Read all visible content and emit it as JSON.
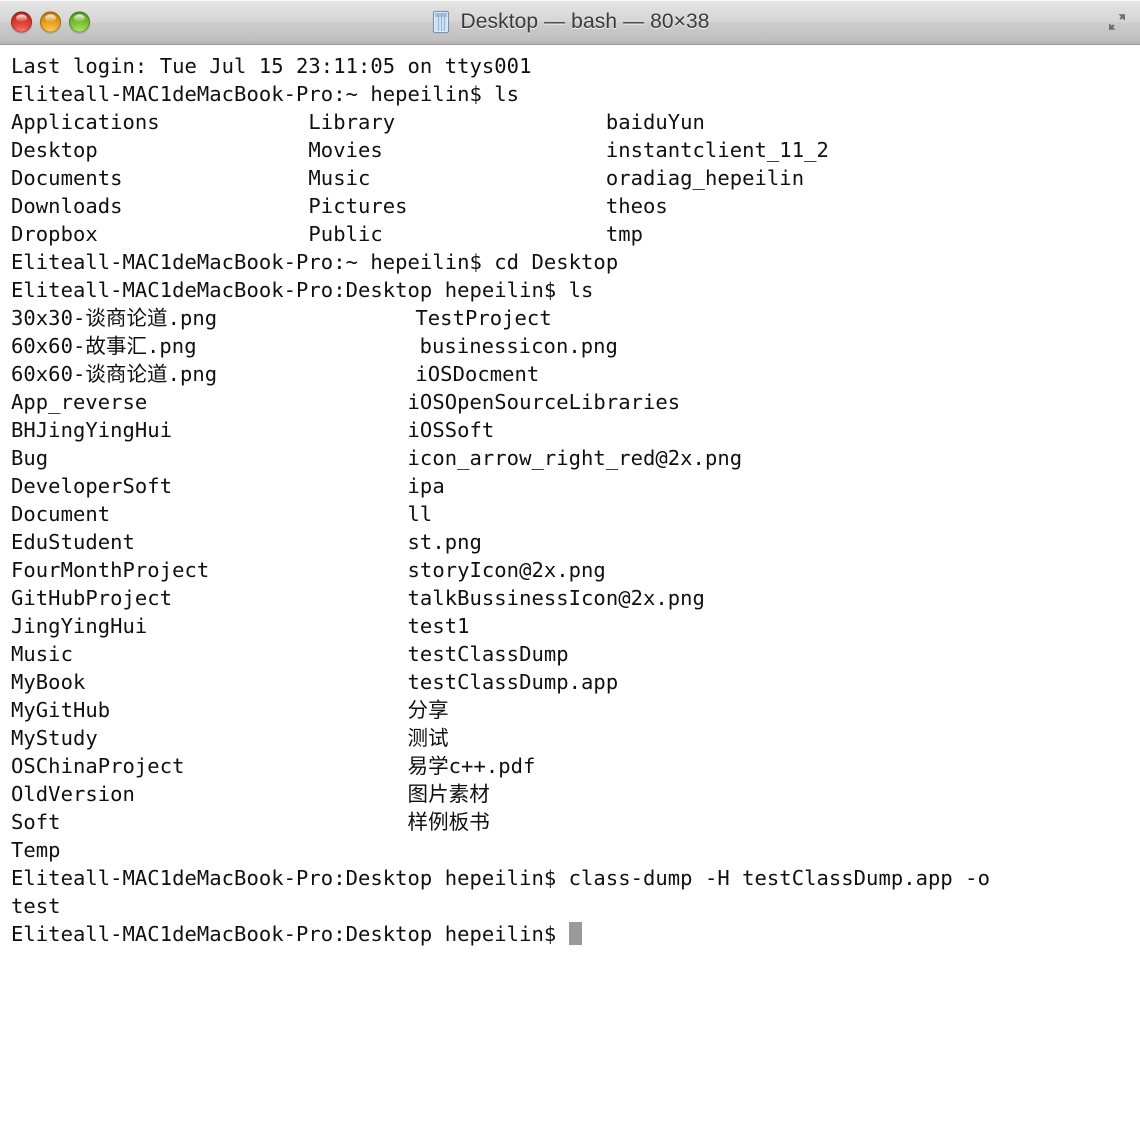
{
  "window": {
    "title": "Desktop — bash — 80×38",
    "title_icon": "terminal-document-icon",
    "buttons": {
      "close": "close-button",
      "minimize": "minimize-button",
      "zoom": "zoom-button",
      "fullscreen": "fullscreen-button"
    }
  },
  "colors": {
    "background": "#ffffff",
    "foreground": "#101010",
    "cursor": "#9a9a9a",
    "titlebar_top": "#e9e9e9",
    "titlebar_bottom": "#b2b2b2",
    "close_red": "#e8463c",
    "minimize_yellow": "#f0ab28",
    "zoom_green": "#87c93d"
  },
  "terminal": {
    "cols": 80,
    "rows": 38,
    "shell": "bash",
    "lines": [
      "Last login: Tue Jul 15 23:11:05 on ttys001",
      "Eliteall-MAC1deMacBook-Pro:~ hepeilin$ ls",
      "Applications            Library                 baiduYun",
      "Desktop                 Movies                  instantclient_11_2",
      "Documents               Music                   oradiag_hepeilin",
      "Downloads               Pictures                theos",
      "Dropbox                 Public                  tmp",
      "Eliteall-MAC1deMacBook-Pro:~ hepeilin$ cd Desktop",
      "Eliteall-MAC1deMacBook-Pro:Desktop hepeilin$ ls",
      "30x30-谈商论道.png                TestProject",
      "60x60-故事汇.png                  businessicon.png",
      "60x60-谈商论道.png                iOSDocment",
      "App_reverse                     iOSOpenSourceLibraries",
      "BHJingYingHui                   iOSSoft",
      "Bug                             icon_arrow_right_red@2x.png",
      "DeveloperSoft                   ipa",
      "Document                        ll",
      "EduStudent                      st.png",
      "FourMonthProject                storyIcon@2x.png",
      "GitHubProject                   talkBussinessIcon@2x.png",
      "JingYingHui                     test1",
      "Music                           testClassDump",
      "MyBook                          testClassDump.app",
      "MyGitHub                        分享",
      "MyStudy                         测试",
      "OSChinaProject                  易学c++.pdf",
      "OldVersion                      图片素材",
      "Soft                            样例板书",
      "Temp",
      "Eliteall-MAC1deMacBook-Pro:Desktop hepeilin$ class-dump -H testClassDump.app -o",
      "test",
      "Eliteall-MAC1deMacBook-Pro:Desktop hepeilin$ "
    ],
    "prompt_host": "Eliteall-MAC1deMacBook-Pro",
    "user": "hepeilin",
    "commands": [
      "ls",
      "cd Desktop",
      "ls",
      "class-dump -H testClassDump.app -o test"
    ],
    "last_login": "Last login: Tue Jul 15 23:11:05 on ttys001",
    "cursor_visible": true
  }
}
